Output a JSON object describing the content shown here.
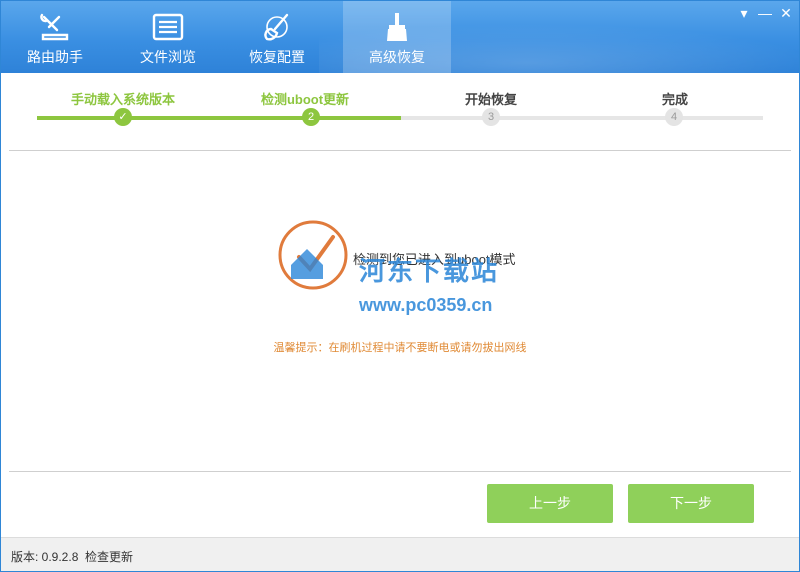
{
  "window": {
    "controls": {
      "menu": "▾",
      "minimize": "—",
      "close": "✕"
    }
  },
  "tabs": [
    {
      "label": "路由助手",
      "icon": "router-tools-icon"
    },
    {
      "label": "文件浏览",
      "icon": "file-list-icon"
    },
    {
      "label": "恢复配置",
      "icon": "brush-icon"
    },
    {
      "label": "高级恢复",
      "icon": "broom-icon",
      "active": true
    }
  ],
  "steps": [
    {
      "label": "手动载入系统版本",
      "status": "done",
      "marker": "✓"
    },
    {
      "label": "检测uboot更新",
      "status": "current",
      "marker": "2"
    },
    {
      "label": "开始恢复",
      "status": "pending",
      "marker": "3"
    },
    {
      "label": "完成",
      "status": "pending",
      "marker": "4"
    }
  ],
  "main": {
    "message": "检测到您已进入到uboot模式",
    "tip": "温馨提示：在刷机过程中请不要断电或请勿拔出网线"
  },
  "watermark": {
    "title": "河东下载站",
    "url": "www.pc0359.cn"
  },
  "buttons": {
    "prev": "上一步",
    "next": "下一步"
  },
  "footer": {
    "version": "版本: 0.9.2.8",
    "check_update": "检查更新"
  },
  "colors": {
    "accent": "#8dc63f",
    "header": "#3a8fe2",
    "tip": "#e08a35"
  }
}
